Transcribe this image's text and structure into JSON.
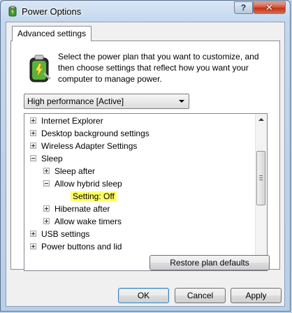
{
  "window": {
    "title": "Power Options",
    "help_label": "?",
    "close_label": "✕"
  },
  "tab": {
    "label": "Advanced settings"
  },
  "description": "Select the power plan that you want to customize, and then choose settings that reflect how you want your computer to manage power.",
  "plan_select": {
    "value": "High performance [Active]"
  },
  "tree": {
    "items": [
      {
        "label": "Internet Explorer",
        "toggle": "+"
      },
      {
        "label": "Desktop background settings",
        "toggle": "+"
      },
      {
        "label": "Wireless Adapter Settings",
        "toggle": "+"
      },
      {
        "label": "Sleep",
        "toggle": "-"
      },
      {
        "label": "Sleep after",
        "toggle": "+"
      },
      {
        "label": "Allow hybrid sleep",
        "toggle": "-"
      },
      {
        "label": "Setting:",
        "value": "Off"
      },
      {
        "label": "Hibernate after",
        "toggle": "+"
      },
      {
        "label": "Allow wake timers",
        "toggle": "+"
      },
      {
        "label": "USB settings",
        "toggle": "+"
      },
      {
        "label": "Power buttons and lid",
        "toggle": "+"
      }
    ]
  },
  "buttons": {
    "restore": "Restore plan defaults",
    "ok": "OK",
    "cancel": "Cancel",
    "apply": "Apply"
  },
  "colors": {
    "highlight": "#ffff66",
    "close": "#c13418"
  }
}
